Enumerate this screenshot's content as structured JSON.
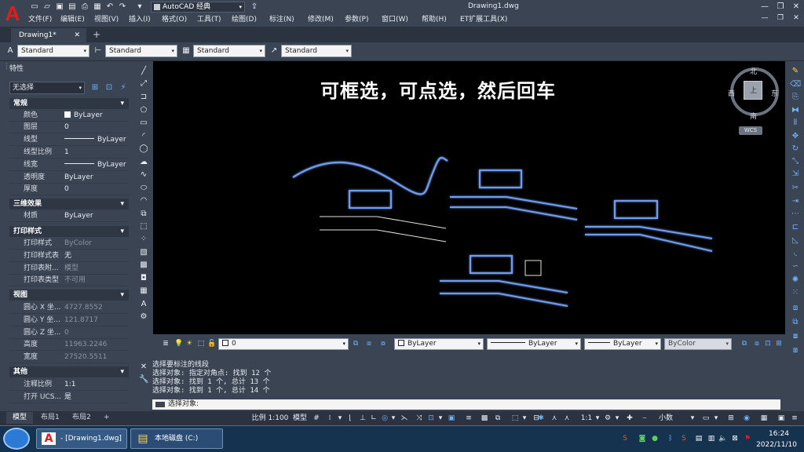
{
  "app": {
    "workspace": "AutoCAD 经典",
    "window_title": "Drawing1.dwg",
    "menus": [
      "文件(F)",
      "编辑(E)",
      "视图(V)",
      "插入(I)",
      "格式(O)",
      "工具(T)",
      "绘图(D)",
      "标注(N)",
      "修改(M)",
      "参数(P)",
      "窗口(W)",
      "帮助(H)",
      "ET扩展工具(X)"
    ],
    "doc_tab": "Drawing1*"
  },
  "styles": {
    "text_style": "Standard",
    "dim_style": "Standard",
    "table_style": "Standard",
    "mleader_style": "Standard"
  },
  "properties": {
    "title": "特性",
    "selection": "无选择",
    "sections": {
      "general": "常规",
      "3d": "三维效果",
      "plot": "打印样式",
      "view": "视图",
      "misc": "其他"
    },
    "general": [
      {
        "k": "颜色",
        "v": "ByLayer"
      },
      {
        "k": "图层",
        "v": "0"
      },
      {
        "k": "线型",
        "v": "ByLayer"
      },
      {
        "k": "线型比例",
        "v": "1"
      },
      {
        "k": "线宽",
        "v": "ByLayer"
      },
      {
        "k": "透明度",
        "v": "ByLayer"
      },
      {
        "k": "厚度",
        "v": "0"
      }
    ],
    "threed": [
      {
        "k": "材质",
        "v": "ByLayer"
      }
    ],
    "plot": [
      {
        "k": "打印样式",
        "v": "ByColor"
      },
      {
        "k": "打印样式表",
        "v": "无"
      },
      {
        "k": "打印表附...",
        "v": "模型"
      },
      {
        "k": "打印表类型",
        "v": "不可用"
      }
    ],
    "view": [
      {
        "k": "圆心 X 坐...",
        "v": "4727.8552"
      },
      {
        "k": "圆心 Y 坐...",
        "v": "121.8717"
      },
      {
        "k": "圆心 Z 坐...",
        "v": "0"
      },
      {
        "k": "高度",
        "v": "11963.2246"
      },
      {
        "k": "宽度",
        "v": "27520.5511"
      }
    ],
    "misc": [
      {
        "k": "注释比例",
        "v": "1:1"
      },
      {
        "k": "打开 UCS...",
        "v": "是"
      }
    ]
  },
  "canvas": {
    "overlay_text": "可框选，可点选，然后回车",
    "compass": {
      "north": "北",
      "south": "南",
      "east": "东",
      "west": "西",
      "top": "上",
      "wcs": "WCS"
    }
  },
  "layer_bar": {
    "layer": "0",
    "color": "ByLayer",
    "linetype": "ByLayer",
    "lineweight": "ByLayer",
    "plot_style": "ByColor"
  },
  "command": {
    "history": [
      "选择要标注的线段",
      "选择对象: 指定对角点: 找到 12 个",
      "选择对象: 找到 1 个, 总计 13 个",
      "选择对象: 找到 1 个, 总计 14 个"
    ],
    "prompt": "选择对象:"
  },
  "layout_tabs": [
    "模型",
    "布局1",
    "布局2"
  ],
  "status": {
    "scale": "比例 1:100",
    "model": "模型",
    "anno_scale": "1:1",
    "unit": "小数"
  },
  "taskbar": {
    "task1": "- [Drawing1.dwg]",
    "task2": "本地磁盘 (C:)",
    "time": "16:24",
    "date": "2022/11/10"
  },
  "colors": {
    "canvas_bg": "#000000",
    "entity_blue": "#6f9cf0",
    "entity_white": "#e8e4d8",
    "ui_bg": "#3b4453"
  }
}
